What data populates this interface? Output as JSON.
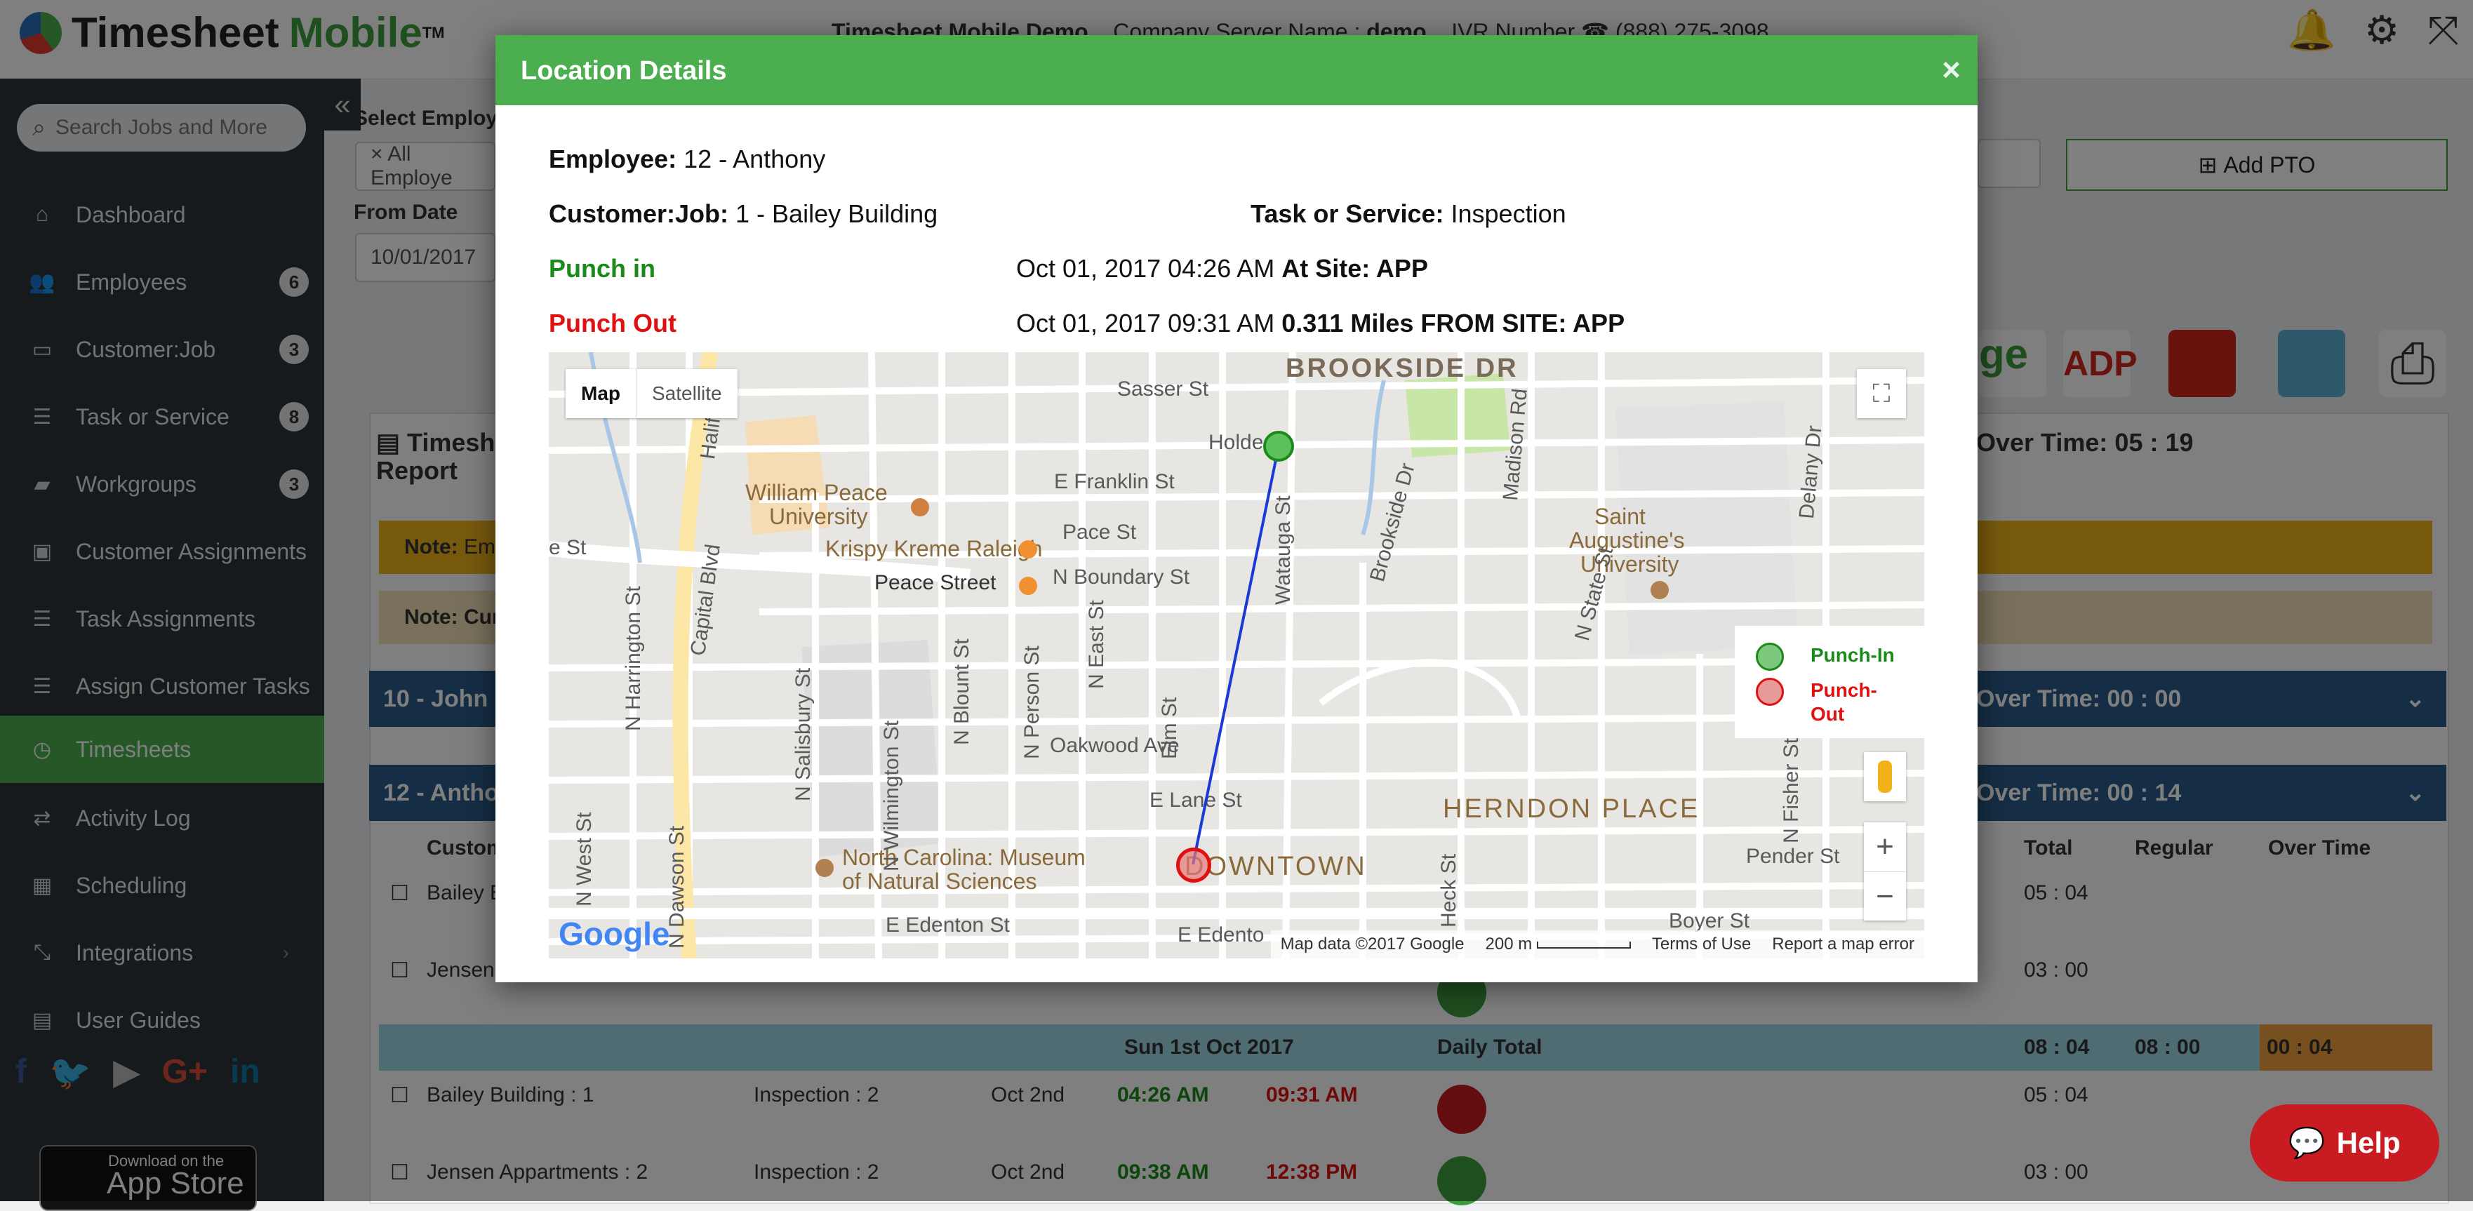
{
  "header": {
    "logo_word1": "Timesheet",
    "logo_word2": "Mobile",
    "logo_tm": "TM",
    "info_demo": "Timesheet Mobile Demo",
    "info_server_label": "Company Server Name :",
    "info_server_value": "demo",
    "info_ivr_label": "IVR Number",
    "info_ivr_value": "(888) 275-3098"
  },
  "sidebar": {
    "search_placeholder": "Search Jobs and More",
    "items": [
      {
        "label": "Dashboard",
        "icon": "home-icon"
      },
      {
        "label": "Employees",
        "badge": "6",
        "icon": "users-icon"
      },
      {
        "label": "Customer:Job",
        "badge": "3",
        "icon": "laptop-icon"
      },
      {
        "label": "Task or Service",
        "badge": "8",
        "icon": "list-icon"
      },
      {
        "label": "Workgroups",
        "badge": "3",
        "icon": "folder-icon"
      },
      {
        "label": "Customer Assignments",
        "icon": "briefcase-icon"
      },
      {
        "label": "Task Assignments",
        "icon": "list-icon"
      },
      {
        "label": "Assign Customer Tasks",
        "icon": "list-icon"
      },
      {
        "label": "Timesheets",
        "icon": "clock-icon",
        "active": true
      },
      {
        "label": "Activity Log",
        "icon": "exchange-icon"
      },
      {
        "label": "Scheduling",
        "icon": "calendar-icon"
      },
      {
        "label": "Integrations",
        "icon": "compress-icon"
      },
      {
        "label": "User Guides",
        "icon": "book-icon"
      }
    ],
    "appstore_small": "Download on the",
    "appstore_big": "App Store"
  },
  "background": {
    "select_employee_label": "Select Employ",
    "employee_chip": "× All Employe",
    "from_date_label": "From Date",
    "from_date_value": "10/01/2017",
    "add_pto": "Add PTO",
    "report_title_1": "Timesh",
    "report_title_2": "Report",
    "over_time_total": "Over Time: 05 : 19",
    "note1_bold": "Note:",
    "note1_text": "Em",
    "note2_bold": "Note: Curr",
    "emp_row1": "10 - John",
    "emp_row1_ot": "Over Time: 00 : 00",
    "emp_row2": "12 - Antho",
    "emp_row2_ot": "Over Time: 00 : 14",
    "col_customer": "Custom",
    "col_total": "Total",
    "col_regular": "Regular",
    "col_overtime": "Over Time",
    "row_a_customer": "Bailey E",
    "row_a_total": "05 : 04",
    "row_b_customer": "Jensen",
    "row_b_total": "03 : 00",
    "daily_date": "Sun 1st Oct 2017",
    "daily_label": "Daily Total",
    "daily_total": "08 : 04",
    "daily_regular": "08 : 00",
    "daily_ot": "00 : 04",
    "rows": [
      {
        "customer": "Bailey Building : 1",
        "task": "Inspection : 2",
        "date": "Oct 2nd",
        "in": "04:26 AM",
        "out": "09:31 AM",
        "total": "05 : 04"
      },
      {
        "customer": "Jensen Appartments : 2",
        "task": "Inspection : 2",
        "date": "Oct 2nd",
        "in": "09:38 AM",
        "out": "12:38 PM",
        "total": "03 : 00"
      }
    ],
    "help": "Help"
  },
  "modal": {
    "title": "Location Details",
    "close": "×",
    "employee_label": "Employee:",
    "employee_value": "12 - Anthony",
    "customer_label": "Customer:Job:",
    "customer_value": "1 - Bailey Building",
    "task_label": "Task or Service:",
    "task_value": "Inspection",
    "punch_in_label": "Punch in",
    "punch_in_time": "Oct 01, 2017 04:26 AM",
    "punch_in_site": "At Site: APP",
    "punch_out_label": "Punch Out",
    "punch_out_time": "Oct 01, 2017 09:31 AM",
    "punch_out_site": "0.311 Miles FROM SITE: APP"
  },
  "map": {
    "type_map": "Map",
    "type_satellite": "Satellite",
    "legend_in": "Punch-In",
    "legend_out_1": "Punch-",
    "legend_out_2": "Out",
    "attrib_data": "Map data ©2017 Google",
    "attrib_scale": "200 m",
    "attrib_terms": "Terms of Use",
    "attrib_report": "Report a map error",
    "google": "Google",
    "labels": {
      "brookside": "BROOKSIDE DR",
      "sasser": "Sasser St",
      "holden": "Holde",
      "efranklin": "E Franklin St",
      "pace": "Pace St",
      "wpu1": "William Peace",
      "wpu2": "University",
      "krispy": "Krispy Kreme Raleigh",
      "peace": "Peace Street",
      "nboundary": "N Boundary St",
      "saint1": "Saint",
      "saint2": "Augustine's",
      "saint3": "University",
      "capital": "Capital Blvd",
      "oakwood": "Oakwood Ave",
      "elane": "E Lane St",
      "herndon": "HERNDON PLACE",
      "ncm1": "North Carolina: Museum",
      "ncm2": "of Natural Sciences",
      "downtown": "DOWNTOWN",
      "pender": "Pender St",
      "boyer": "Boyer St",
      "eedenton": "E Edenton St",
      "eedenton2": "E Edento",
      "halifax": "Halifax St",
      "est": "e St",
      "nharrington": "N Harrington St",
      "nwest": "N West St",
      "ndawson": "N Dawson St",
      "nsalisbury": "N Salisbury St",
      "nwilmington": "N Wilmington St",
      "nblount": "N Blount St",
      "nperson": "N Person St",
      "neast": "N East St",
      "elm": "Elm St",
      "watauga": "Watauga St",
      "brooksidedr": "Brookside Dr",
      "madison": "Madison Rd",
      "nstate": "N State St",
      "delany": "Delany Dr",
      "heck": "Heck St",
      "nfisher": "N Fisher St"
    }
  }
}
